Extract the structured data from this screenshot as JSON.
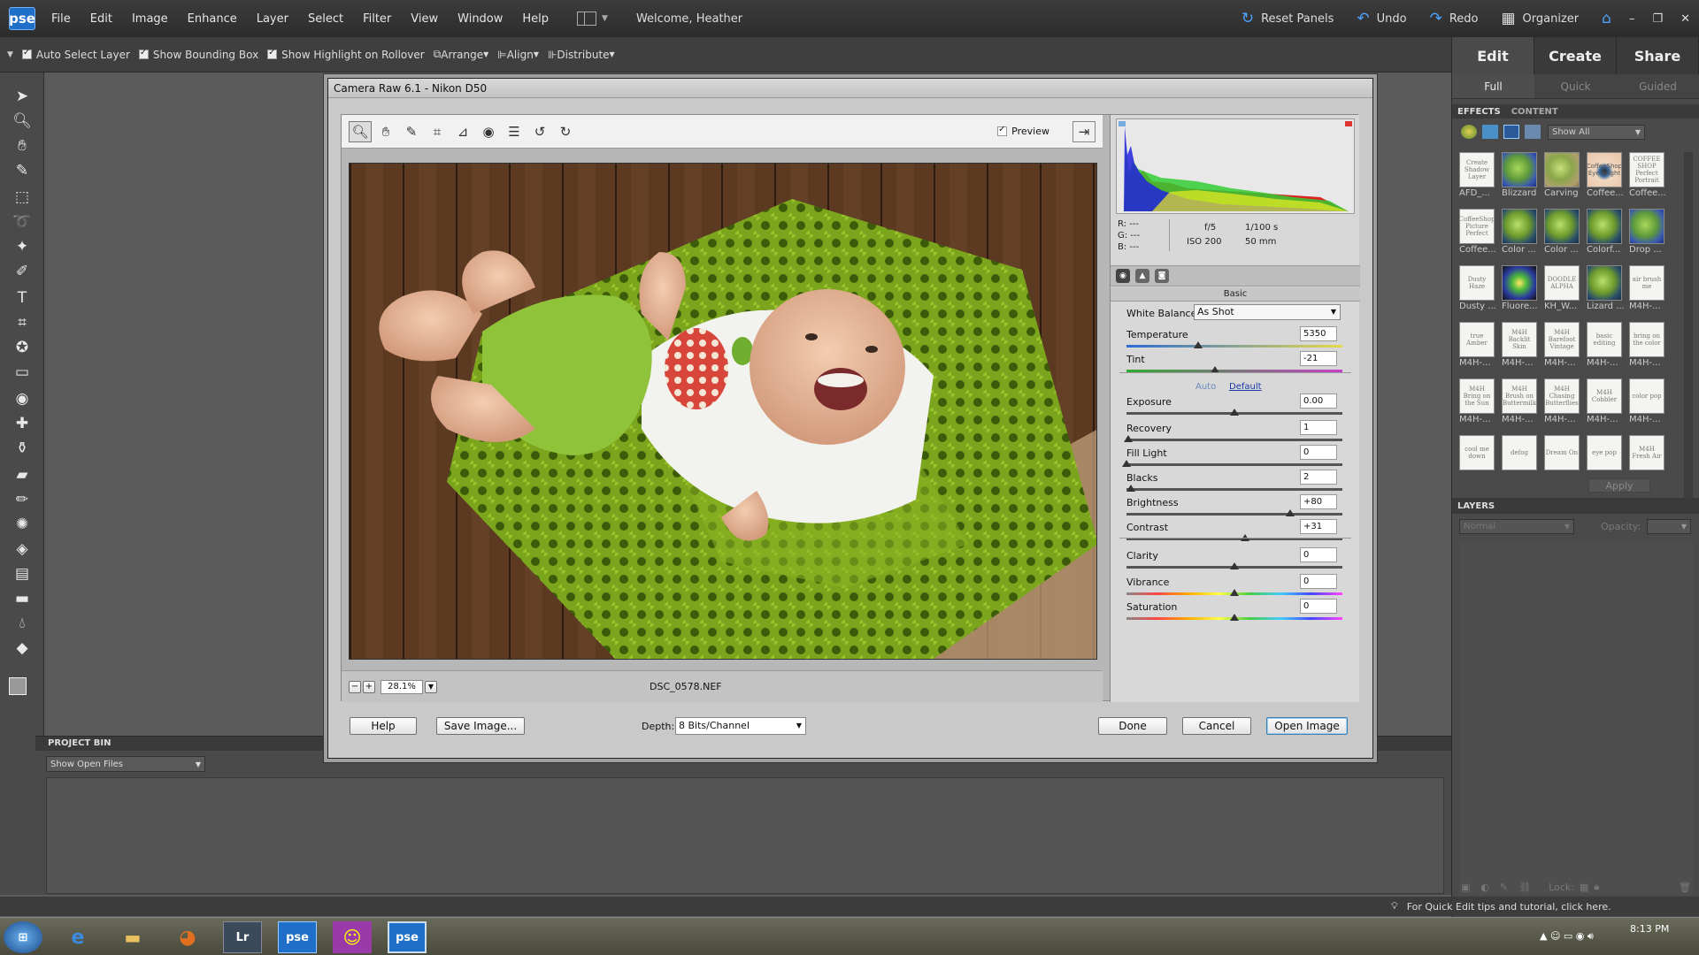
{
  "app": {
    "logo": "pse",
    "menu": [
      "File",
      "Edit",
      "Image",
      "Enhance",
      "Layer",
      "Select",
      "Filter",
      "View",
      "Window",
      "Help"
    ],
    "welcome": "Welcome, Heather",
    "right_actions": {
      "reset": "Reset Panels",
      "undo": "Undo",
      "redo": "Redo",
      "organizer": "Organizer"
    }
  },
  "options": {
    "auto_select": "Auto Select Layer",
    "show_bbox": "Show Bounding Box",
    "show_highlight": "Show Highlight on Rollover",
    "arrange": "Arrange",
    "align": "Align",
    "distribute": "Distribute"
  },
  "right_panel": {
    "mode_tabs": [
      "Edit",
      "Create",
      "Share"
    ],
    "sub_tabs": [
      "Full",
      "Quick",
      "Guided"
    ],
    "panel_tabs": [
      "EFFECTS",
      "CONTENT"
    ],
    "show_all": "Show All",
    "apply": "Apply",
    "layers_title": "LAYERS",
    "blend_mode": "Normal",
    "opacity_label": "Opacity:",
    "lock_label": "Lock:",
    "effects": [
      {
        "label": "AFD_...",
        "thumb": "Create Shadow Layer",
        "style": "white"
      },
      {
        "label": "Blizzard",
        "thumb": "",
        "style": "blue"
      },
      {
        "label": "Carving",
        "thumb": "",
        "style": "apple2"
      },
      {
        "label": "Coffee...",
        "thumb": "CoffeeShop Eye Bright",
        "style": "eye"
      },
      {
        "label": "Coffee...",
        "thumb": "COFFEE SHOP Perfect Portrait",
        "style": "white"
      },
      {
        "label": "Coffee...",
        "thumb": "CoffeeShop Picture Perfect",
        "style": "white"
      },
      {
        "label": "Color ...",
        "thumb": "",
        "style": "apple"
      },
      {
        "label": "Color ...",
        "thumb": "",
        "style": "apple"
      },
      {
        "label": "Colorf...",
        "thumb": "",
        "style": "apple"
      },
      {
        "label": "Drop ...",
        "thumb": "",
        "style": "blue"
      },
      {
        "label": "Dusty ...",
        "thumb": "Dusty Haze",
        "style": "white"
      },
      {
        "label": "Fluore...",
        "thumb": "",
        "style": "fluoro"
      },
      {
        "label": "KH_W...",
        "thumb": "DOODLE ALPHA",
        "style": "white"
      },
      {
        "label": "Lizard ...",
        "thumb": "",
        "style": "apple"
      },
      {
        "label": "M4H-...",
        "thumb": "air brush me",
        "style": "white"
      },
      {
        "label": "M4H-...",
        "thumb": "true Amber",
        "style": "white"
      },
      {
        "label": "M4H-...",
        "thumb": "M4H Backlit Skin",
        "style": "white"
      },
      {
        "label": "M4H-...",
        "thumb": "M4H Barefoot Vintage",
        "style": "white"
      },
      {
        "label": "M4H-...",
        "thumb": "basic editing",
        "style": "white"
      },
      {
        "label": "M4H-...",
        "thumb": "bring on the color",
        "style": "white"
      },
      {
        "label": "M4H-...",
        "thumb": "M4H Bring on the Sun",
        "style": "white"
      },
      {
        "label": "M4H-...",
        "thumb": "M4H Brush on Buttermilk",
        "style": "white"
      },
      {
        "label": "M4H-...",
        "thumb": "M4H Chasing Butterflies",
        "style": "white"
      },
      {
        "label": "M4H-...",
        "thumb": "M4H Cobbler",
        "style": "white"
      },
      {
        "label": "M4H-...",
        "thumb": "color pop",
        "style": "white"
      },
      {
        "label": "",
        "thumb": "cool me down",
        "style": "white"
      },
      {
        "label": "",
        "thumb": "defog",
        "style": "white"
      },
      {
        "label": "",
        "thumb": "Dream On",
        "style": "white"
      },
      {
        "label": "",
        "thumb": "eye pop",
        "style": "white"
      },
      {
        "label": "",
        "thumb": "M4H Fresh Air",
        "style": "white"
      }
    ]
  },
  "project_bin": {
    "title": "PROJECT BIN",
    "filter": "Show Open Files"
  },
  "status": {
    "tip": "For Quick Edit tips and tutorial, click here."
  },
  "dialog": {
    "title": "Camera Raw 6.1  -  Nikon D50",
    "preview_label": "Preview",
    "zoom": "28.1%",
    "filename": "DSC_0578.NEF",
    "rgb": {
      "r": "R:   ---",
      "g": "G:   ---",
      "b": "B:   ---"
    },
    "exif": {
      "aperture": "f/5",
      "shutter": "1/100 s",
      "iso": "ISO 200",
      "focal": "50 mm"
    },
    "panel_title": "Basic",
    "white_balance_label": "White Balance:",
    "white_balance": "As Shot",
    "auto": "Auto",
    "default": "Default",
    "depth_label": "Depth:",
    "depth": "8 Bits/Channel",
    "buttons": {
      "help": "Help",
      "save": "Save Image...",
      "done": "Done",
      "cancel": "Cancel",
      "open": "Open Image"
    },
    "sliders": [
      {
        "name": "Temperature",
        "value": "5350",
        "pos": 0.33,
        "track": "temp"
      },
      {
        "name": "Tint",
        "value": "-21",
        "pos": 0.41,
        "track": "tint"
      },
      {
        "name": "Exposure",
        "value": "0.00",
        "pos": 0.5,
        "track": "plain"
      },
      {
        "name": "Recovery",
        "value": "1",
        "pos": 0.01,
        "track": "plain"
      },
      {
        "name": "Fill Light",
        "value": "0",
        "pos": 0.0,
        "track": "plain"
      },
      {
        "name": "Blacks",
        "value": "2",
        "pos": 0.02,
        "track": "plain"
      },
      {
        "name": "Brightness",
        "value": "+80",
        "pos": 0.76,
        "track": "plain"
      },
      {
        "name": "Contrast",
        "value": "+31",
        "pos": 0.55,
        "track": "plain"
      },
      {
        "name": "Clarity",
        "value": "0",
        "pos": 0.5,
        "track": "plain"
      },
      {
        "name": "Vibrance",
        "value": "0",
        "pos": 0.5,
        "track": "vib"
      },
      {
        "name": "Saturation",
        "value": "0",
        "pos": 0.5,
        "track": "sat"
      }
    ]
  },
  "taskbar": {
    "items": [
      "Lr",
      "pse",
      "pse"
    ],
    "clock": "8:13 PM"
  }
}
